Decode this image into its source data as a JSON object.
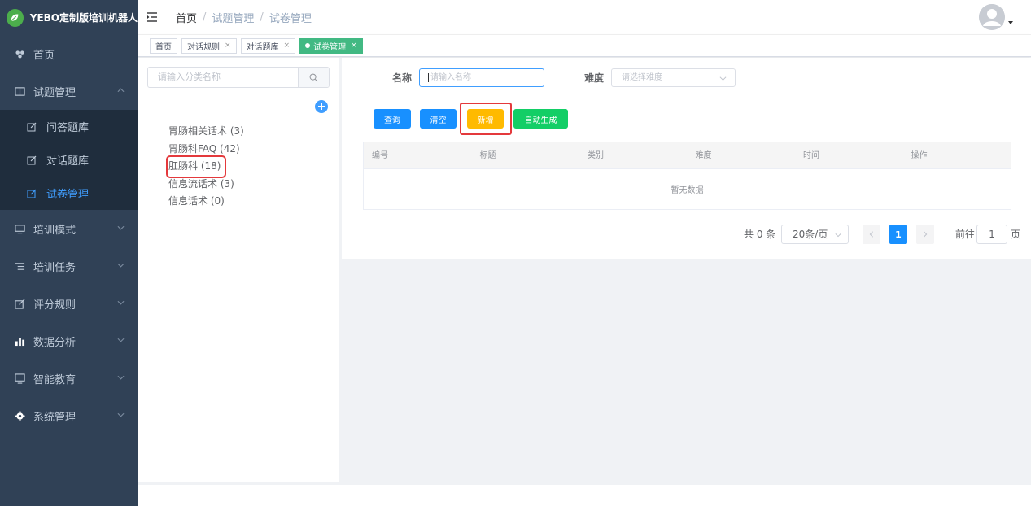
{
  "app": {
    "title": "YEBO定制版培训机器人"
  },
  "sidebar": {
    "items": [
      {
        "label": "首页",
        "icon": "dashboard-icon"
      },
      {
        "label": "试题管理",
        "icon": "book-icon",
        "expanded": true,
        "children": [
          {
            "label": "问答题库",
            "icon": "edit-icon"
          },
          {
            "label": "对话题库",
            "icon": "edit-icon"
          },
          {
            "label": "试卷管理",
            "icon": "edit-icon",
            "active": true
          }
        ]
      },
      {
        "label": "培训模式",
        "icon": "monitor-icon"
      },
      {
        "label": "培训任务",
        "icon": "list-icon"
      },
      {
        "label": "评分规则",
        "icon": "edit-icon"
      },
      {
        "label": "数据分析",
        "icon": "bar-chart-icon"
      },
      {
        "label": "智能教育",
        "icon": "screen-icon"
      },
      {
        "label": "系统管理",
        "icon": "gear-icon"
      }
    ],
    "accent": "#409eff"
  },
  "breadcrumb": {
    "home": "首页",
    "level1": "试题管理",
    "level2": "试卷管理"
  },
  "tags": [
    {
      "label": "首页",
      "closable": false,
      "active": false
    },
    {
      "label": "对话规则",
      "closable": true,
      "active": false
    },
    {
      "label": "对话题库",
      "closable": true,
      "active": false
    },
    {
      "label": "试卷管理",
      "closable": true,
      "active": true
    }
  ],
  "tree": {
    "search_placeholder": "请输入分类名称",
    "nodes": [
      {
        "label": "胃肠相关话术 (3)"
      },
      {
        "label": "胃肠科FAQ (42)"
      },
      {
        "label": "肛肠科 (18)",
        "highlighted": true
      },
      {
        "label": "信息流话术 (3)"
      },
      {
        "label": "信息话术 (0)"
      }
    ]
  },
  "filters": {
    "name_label": "名称",
    "name_placeholder": "请输入名称",
    "difficulty_label": "难度",
    "difficulty_placeholder": "请选择难度"
  },
  "actions": {
    "query": "查询",
    "clear": "清空",
    "add": "新增",
    "auto_generate": "自动生成"
  },
  "table": {
    "columns": [
      "编号",
      "标题",
      "类别",
      "难度",
      "时间",
      "操作"
    ],
    "empty_text": "暂无数据"
  },
  "pagination": {
    "total_text": "共 0 条",
    "page_size": "20条/页",
    "current_page": "1",
    "goto_label": "前往",
    "goto_value": "1",
    "page_suffix": "页"
  },
  "colors": {
    "sidebar_bg": "#304156",
    "primary": "#1890ff",
    "warning": "#ffba00",
    "success": "#13ce66",
    "tag_active": "#42b983",
    "highlight": "#e4393c"
  }
}
